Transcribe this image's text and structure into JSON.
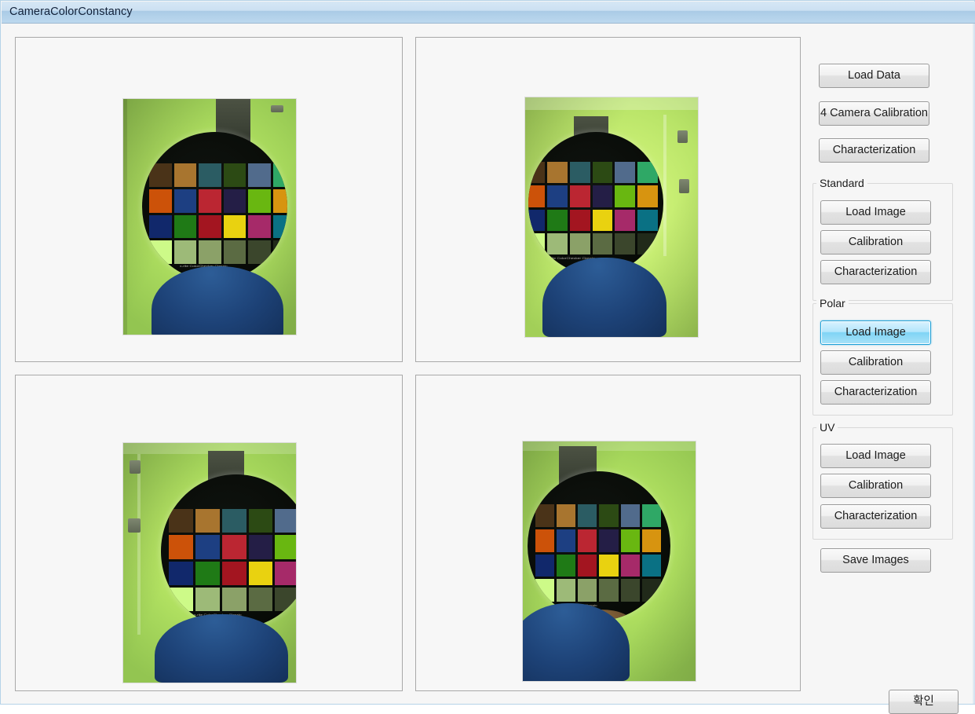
{
  "window": {
    "title": "CameraColorConstancy"
  },
  "toolbar": {
    "load_data_label": "Load Data",
    "four_camera_calibration_label": "4 Camera Calibration",
    "characterization_label": "Characterization"
  },
  "groups": [
    {
      "name": "standard",
      "label": "Standard",
      "buttons": [
        {
          "name": "load-image",
          "label": "Load Image",
          "focused": false
        },
        {
          "name": "calibration",
          "label": "Calibration",
          "focused": false
        },
        {
          "name": "characterization",
          "label": "Characterization",
          "focused": false
        }
      ]
    },
    {
      "name": "polar",
      "label": "Polar",
      "buttons": [
        {
          "name": "load-image",
          "label": "Load Image",
          "focused": true
        },
        {
          "name": "calibration",
          "label": "Calibration",
          "focused": false
        },
        {
          "name": "characterization",
          "label": "Characterization",
          "focused": false
        }
      ]
    },
    {
      "name": "uv",
      "label": "UV",
      "buttons": [
        {
          "name": "load-image",
          "label": "Load Image",
          "focused": false
        },
        {
          "name": "calibration",
          "label": "Calibration",
          "focused": false
        },
        {
          "name": "characterization",
          "label": "Characterization",
          "focused": false
        }
      ]
    }
  ],
  "save_images_label": "Save Images",
  "confirm_label": "확인",
  "colors": {
    "accent": "#1c9fd6",
    "titlebar_top": "#d6e7f5",
    "titlebar_bottom": "#bcd8ee",
    "button_face": "#f0f0f0",
    "client_bg": "#f6f6f6",
    "panel_border": "#a9a9a9"
  },
  "preview_panels": [
    {
      "name": "preview-standard",
      "caption": "ColorChecker chart in illumination booth, camera 1",
      "chart_label": "x-rite  ColorChecker Classic"
    },
    {
      "name": "preview-polar",
      "caption": "ColorChecker chart in illumination booth, camera 2",
      "chart_label": "x-rite  ColorChecker Classic"
    },
    {
      "name": "preview-uv",
      "caption": "ColorChecker chart in illumination booth, camera 3",
      "chart_label": "x-rite  ColorChecker Classic"
    },
    {
      "name": "preview-fourth",
      "caption": "ColorChecker chart in illumination booth, camera 4",
      "chart_label": "x-rite  ColorChecker Classic"
    }
  ],
  "color_checker_patches": [
    "#4a3318",
    "#a8752f",
    "#2b5c63",
    "#2c4a14",
    "#516b8c",
    "#2fa866",
    "#cc5209",
    "#1d3f82",
    "#bb2632",
    "#241e46",
    "#69b711",
    "#d79410",
    "#11286b",
    "#1f7a16",
    "#a31520",
    "#e9d210",
    "#a62a69",
    "#0a7184",
    "#cdfa88",
    "#9dba78",
    "#8ba168",
    "#5b6b43",
    "#3b462c",
    "#212a1a"
  ]
}
